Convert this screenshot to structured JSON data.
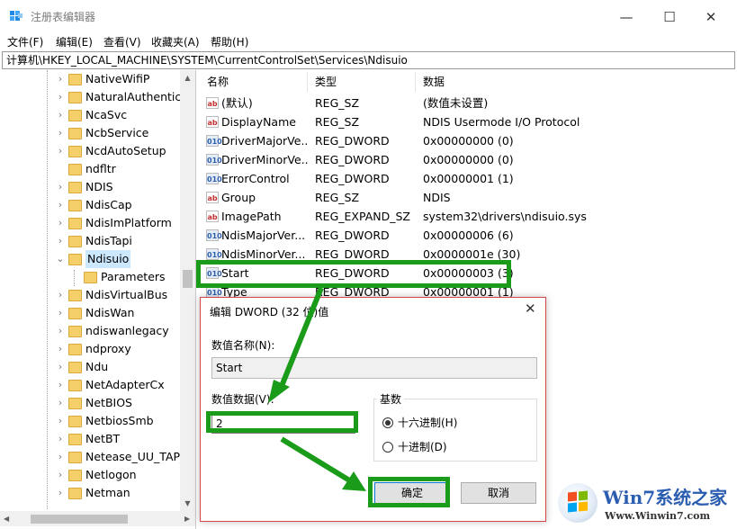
{
  "window": {
    "title": "注册表编辑器",
    "minimize_glyph": "—",
    "maximize_glyph": "☐",
    "close_glyph": "✕"
  },
  "menu": [
    "文件(F)",
    "编辑(E)",
    "查看(V)",
    "收藏夹(A)",
    "帮助(H)"
  ],
  "address": "计算机\\HKEY_LOCAL_MACHINE\\SYSTEM\\CurrentControlSet\\Services\\Ndisuio",
  "tree": {
    "items": [
      {
        "label": "NativeWifiP",
        "expander": "›"
      },
      {
        "label": "NaturalAuthentica",
        "expander": "›"
      },
      {
        "label": "NcaSvc",
        "expander": "›"
      },
      {
        "label": "NcbService",
        "expander": "›"
      },
      {
        "label": "NcdAutoSetup",
        "expander": "›"
      },
      {
        "label": "ndfltr",
        "expander": ""
      },
      {
        "label": "NDIS",
        "expander": "›"
      },
      {
        "label": "NdisCap",
        "expander": "›"
      },
      {
        "label": "NdisImPlatform",
        "expander": "›"
      },
      {
        "label": "NdisTapi",
        "expander": "›"
      },
      {
        "label": "Ndisuio",
        "expander": "⌄"
      },
      {
        "label": "Parameters",
        "expander": ""
      },
      {
        "label": "NdisVirtualBus",
        "expander": "›"
      },
      {
        "label": "NdisWan",
        "expander": "›"
      },
      {
        "label": "ndiswanlegacy",
        "expander": "›"
      },
      {
        "label": "ndproxy",
        "expander": "›"
      },
      {
        "label": "Ndu",
        "expander": "›"
      },
      {
        "label": "NetAdapterCx",
        "expander": "›"
      },
      {
        "label": "NetBIOS",
        "expander": "›"
      },
      {
        "label": "NetbiosSmb",
        "expander": "›"
      },
      {
        "label": "NetBT",
        "expander": "›"
      },
      {
        "label": "Netease_UU_TAP_",
        "expander": "›"
      },
      {
        "label": "Netlogon",
        "expander": "›"
      },
      {
        "label": "Netman",
        "expander": "›"
      }
    ],
    "scroll_up": "▲",
    "scroll_down": "▼",
    "scroll_left": "◀",
    "scroll_right": "▶"
  },
  "columns": {
    "name": "名称",
    "type": "类型",
    "data": "数据"
  },
  "values": [
    {
      "icon": "ab",
      "name": "(默认)",
      "type": "REG_SZ",
      "data": "(数值未设置)"
    },
    {
      "icon": "ab",
      "name": "DisplayName",
      "type": "REG_SZ",
      "data": "NDIS Usermode I/O Protocol"
    },
    {
      "icon": "010",
      "name": "DriverMajorVe...",
      "type": "REG_DWORD",
      "data": "0x00000000 (0)"
    },
    {
      "icon": "010",
      "name": "DriverMinorVe...",
      "type": "REG_DWORD",
      "data": "0x00000000 (0)"
    },
    {
      "icon": "010",
      "name": "ErrorControl",
      "type": "REG_DWORD",
      "data": "0x00000001 (1)"
    },
    {
      "icon": "ab",
      "name": "Group",
      "type": "REG_SZ",
      "data": "NDIS"
    },
    {
      "icon": "ab",
      "name": "ImagePath",
      "type": "REG_EXPAND_SZ",
      "data": "system32\\drivers\\ndisuio.sys"
    },
    {
      "icon": "010",
      "name": "NdisMajorVer...",
      "type": "REG_DWORD",
      "data": "0x00000006 (6)"
    },
    {
      "icon": "010",
      "name": "NdisMinorVer...",
      "type": "REG_DWORD",
      "data": "0x0000001e (30)"
    },
    {
      "icon": "010",
      "name": "Start",
      "type": "REG_DWORD",
      "data": "0x00000003 (3)"
    },
    {
      "icon": "010",
      "name": "Type",
      "type": "REG_DWORD",
      "data": "0x00000001 (1)"
    }
  ],
  "dialog": {
    "title": "编辑 DWORD (32 位)值",
    "close_glyph": "✕",
    "name_label": "数值名称(N):",
    "name_value": "Start",
    "data_label": "数值数据(V):",
    "data_value": "2",
    "base_label": "基数",
    "radio_hex": "十六进制(H)",
    "radio_dec": "十进制(D)",
    "ok": "确定",
    "cancel": "取消"
  },
  "watermark": {
    "brand": "Win7系统之家",
    "url": "Www.Winwin7.com"
  },
  "colors": {
    "highlight": "#1a9c1a",
    "dialog_border": "#d64848",
    "selection": "#cce8ff"
  }
}
